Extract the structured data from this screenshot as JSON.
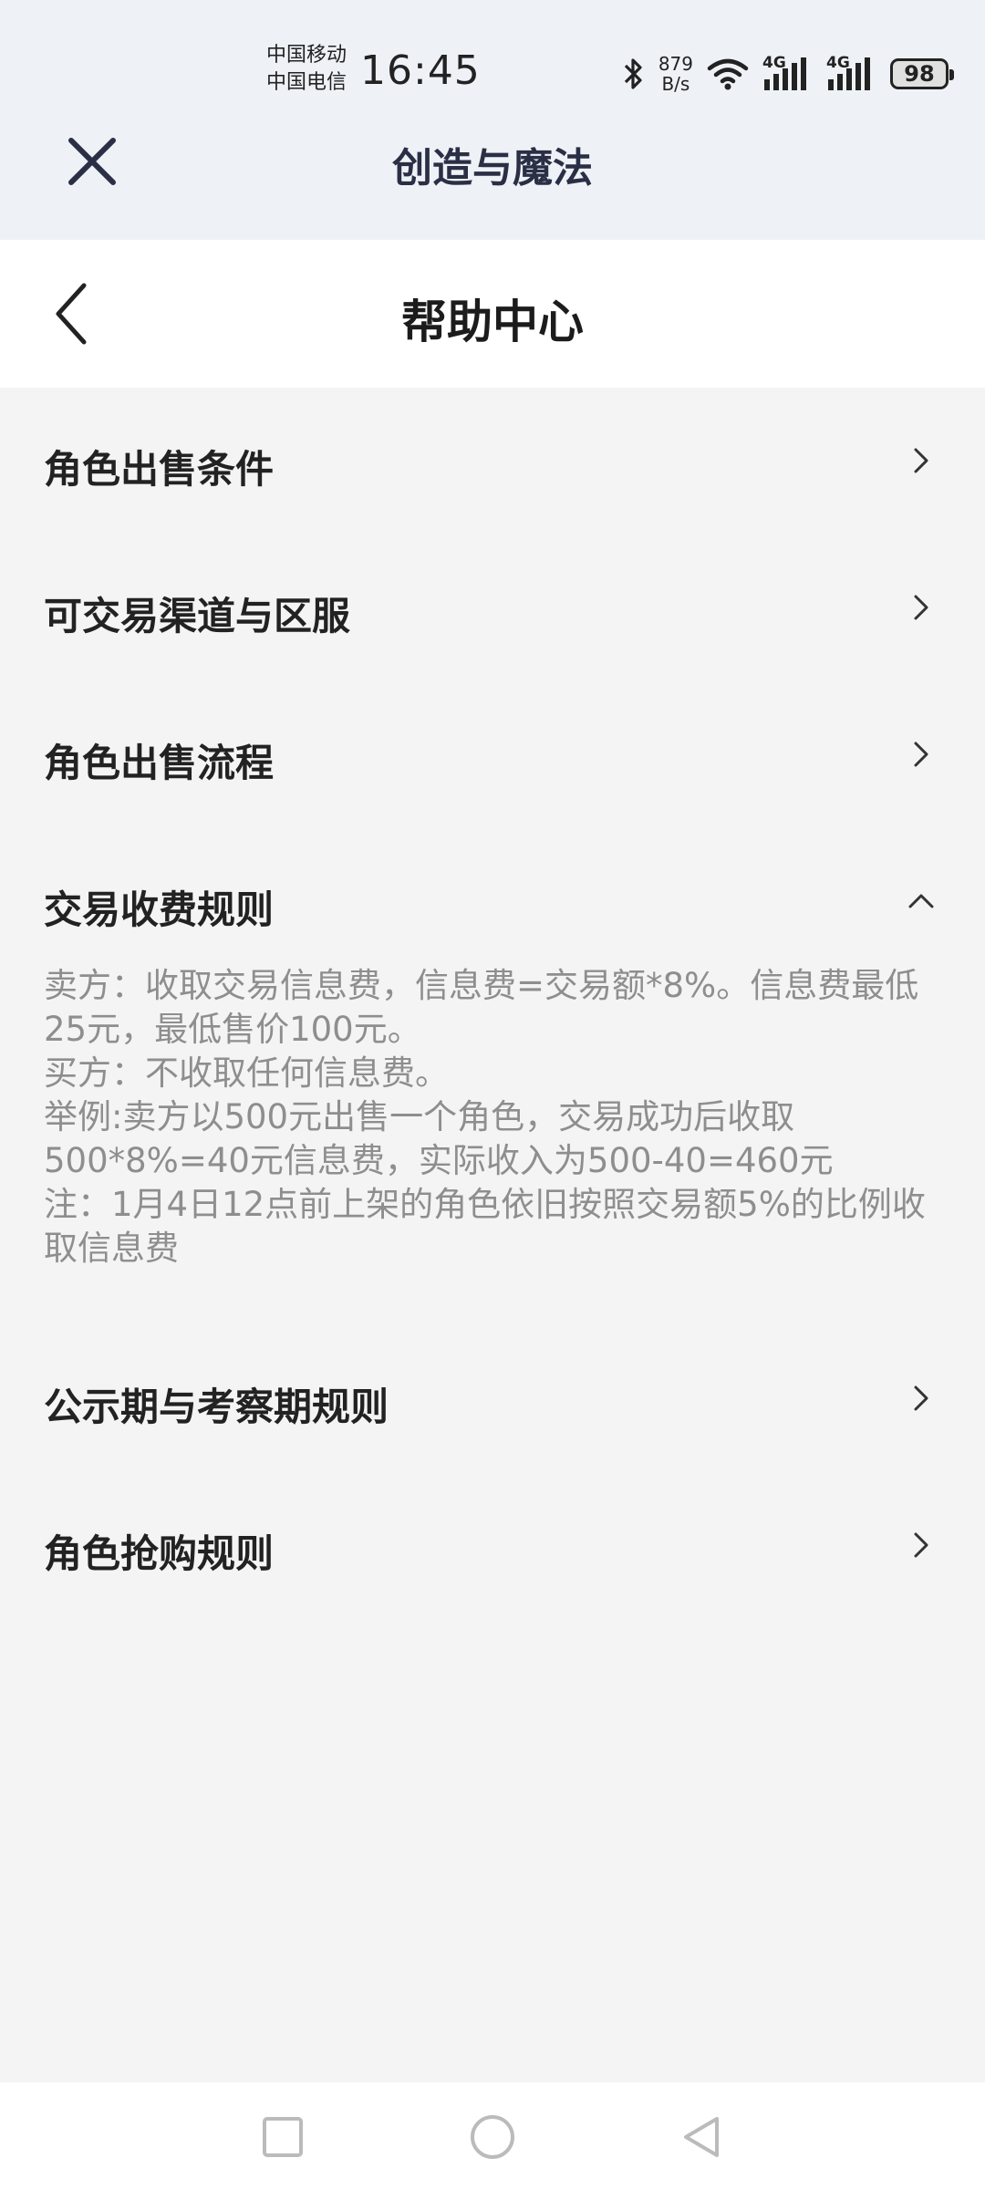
{
  "status_bar": {
    "carrier_1": "中国移动",
    "carrier_2": "中国电信",
    "time": "16:45",
    "speed_value": "879",
    "speed_unit": "B/s",
    "network_1": "4G",
    "network_2": "4G",
    "battery": "98"
  },
  "mini_app": {
    "title": "创造与魔法"
  },
  "page": {
    "title": "帮助中心"
  },
  "faq": {
    "items": [
      {
        "label": "角色出售条件"
      },
      {
        "label": "可交易渠道与区服"
      },
      {
        "label": "角色出售流程"
      },
      {
        "label": "交易收费规则",
        "lines": [
          "卖方：收取交易信息费，信息费=交易额*8%。信息费最低25元，最低售价100元。",
          "买方：不收取任何信息费。",
          "举例:卖方以500元出售一个角色，交易成功后收取500*8%=40元信息费，实际收入为500-40=460元",
          "注：1月4日12点前上架的角色依旧按照交易额5%的比例收取信息费"
        ]
      },
      {
        "label": "公示期与考察期规则"
      },
      {
        "label": "角色抢购规则"
      }
    ]
  },
  "colors": {
    "top_background": "#eef2f7",
    "page_background": "#f4f4f4",
    "body_text": "#8e8e8e"
  }
}
